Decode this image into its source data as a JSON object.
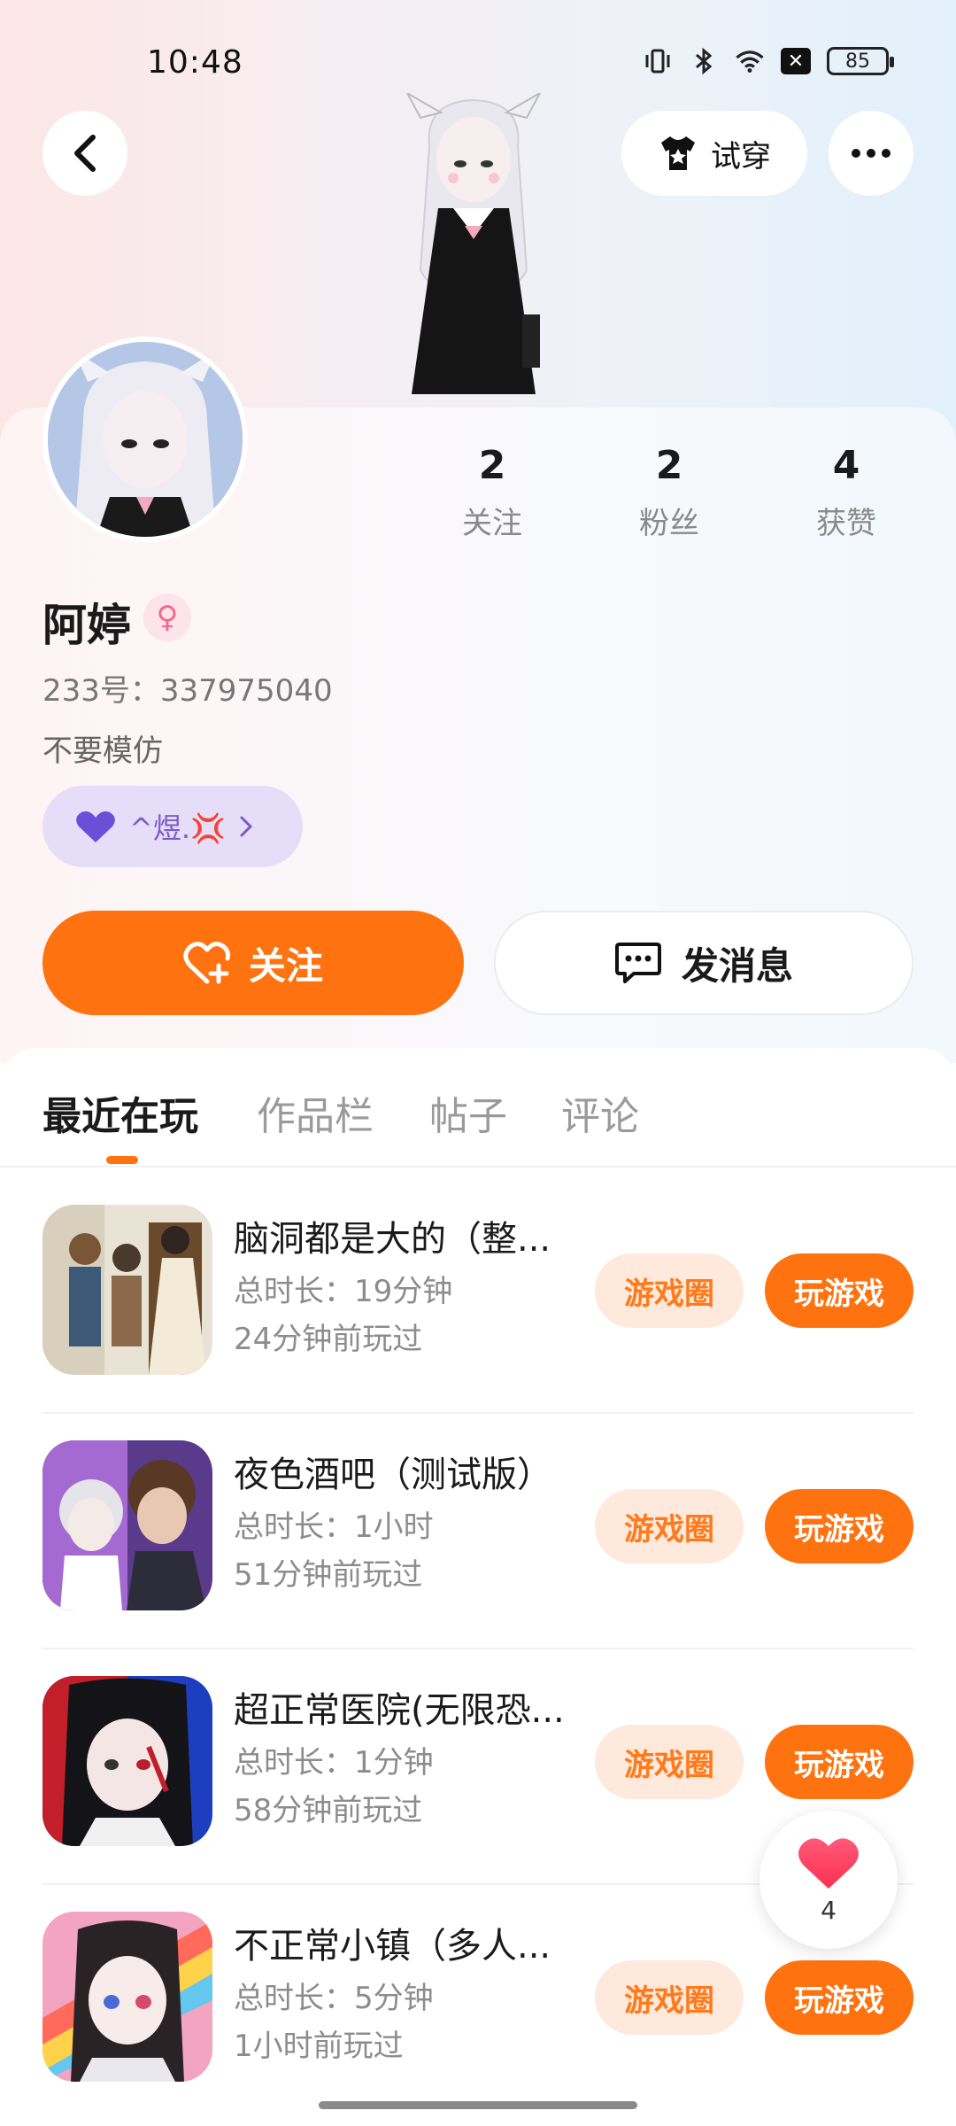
{
  "status_bar": {
    "time": "10:48",
    "battery": "85"
  },
  "header": {
    "try_on_label": "试穿"
  },
  "profile": {
    "username": "阿婷",
    "gender_symbol": "♀",
    "user_id": "233号：337975040",
    "bio": "不要模仿",
    "cp_tag": "^煜.💢",
    "stats": [
      {
        "value": "2",
        "label": "关注"
      },
      {
        "value": "2",
        "label": "粉丝"
      },
      {
        "value": "4",
        "label": "获赞"
      }
    ]
  },
  "actions": {
    "follow_label": "关注",
    "message_label": "发消息"
  },
  "tabs": [
    {
      "label": "最近在玩"
    },
    {
      "label": "作品栏"
    },
    {
      "label": "帖子"
    },
    {
      "label": "评论"
    }
  ],
  "games": [
    {
      "title": "脑洞都是大的（整...",
      "duration": "总时长：19分钟",
      "last_played": "24分钟前玩过",
      "circle_label": "游戏圈",
      "play_label": "玩游戏"
    },
    {
      "title": "夜色酒吧（测试版）",
      "duration": "总时长：1小时",
      "last_played": "51分钟前玩过",
      "circle_label": "游戏圈",
      "play_label": "玩游戏"
    },
    {
      "title": "超正常医院(无限恐...",
      "duration": "总时长：1分钟",
      "last_played": "58分钟前玩过",
      "circle_label": "游戏圈",
      "play_label": "玩游戏"
    },
    {
      "title": "不正常小镇（多人...",
      "duration": "总时长：5分钟",
      "last_played": "1小时前玩过",
      "circle_label": "游戏圈",
      "play_label": "玩游戏"
    }
  ],
  "like_float": {
    "count": "4"
  },
  "colors": {
    "accent": "#ff7210",
    "circle_bg": "#ffe8dc",
    "cp_chip_bg": "#e6ddf8"
  },
  "icons": [
    "back-arrow-icon",
    "tshirt-icon",
    "more-dots-icon",
    "heart-plus-icon",
    "chat-bubble-icon",
    "heart-icon",
    "purple-heart-icon",
    "chevron-right-icon"
  ]
}
